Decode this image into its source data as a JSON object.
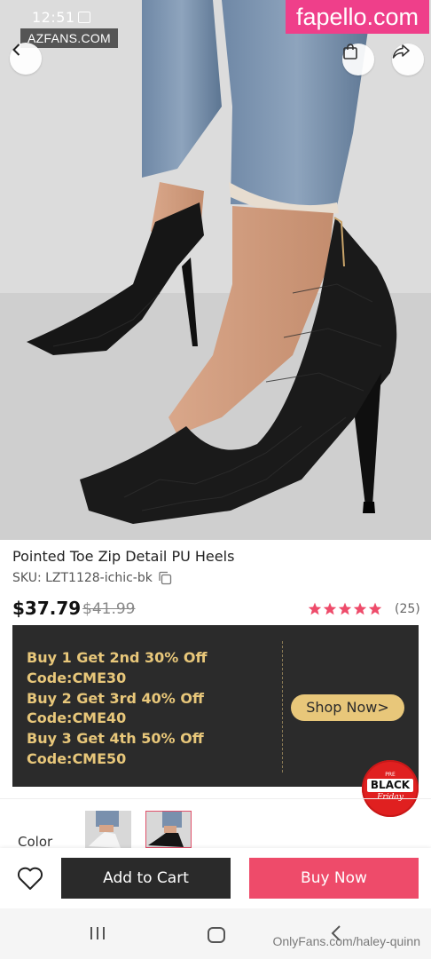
{
  "status_bar": {
    "time": "12:51"
  },
  "watermarks": {
    "top_left": "AZFANS.COM",
    "top_right": "fapello.com",
    "bottom_right": "OnlyFans.com/haley-quinn"
  },
  "header": {
    "back_icon": "chevron-left-icon",
    "bag_icon": "shopping-bag-icon",
    "share_icon": "share-arrow-icon"
  },
  "product": {
    "title": "Pointed Toe Zip Detail PU Heels",
    "sku": "SKU: LZT1128-ichic-bk",
    "price": "$37.79",
    "original_price": "$41.99",
    "rating": 5,
    "review_count": "(25)"
  },
  "promo": {
    "lines": [
      "Buy 1 Get 2nd 30% Off",
      "Code:CME30",
      "Buy 2 Get 3rd 40% Off",
      "Code:CME40",
      "Buy 3 Get 4th 50% Off",
      "Code:CME50"
    ],
    "button_label": "Shop Now>",
    "badge": {
      "pre": "PRE",
      "black": "BLACK",
      "friday": "Friday"
    }
  },
  "color": {
    "label": "Color",
    "selected_index": 1
  },
  "actions": {
    "add_to_cart": "Add to Cart",
    "buy_now": "Buy Now"
  },
  "colors": {
    "accent": "#ee4b6a",
    "dark": "#2a2a2a",
    "gold": "#e8c77a",
    "promo_bg": "#2b2b2b",
    "watermark_pink": "#ef3f8a"
  }
}
